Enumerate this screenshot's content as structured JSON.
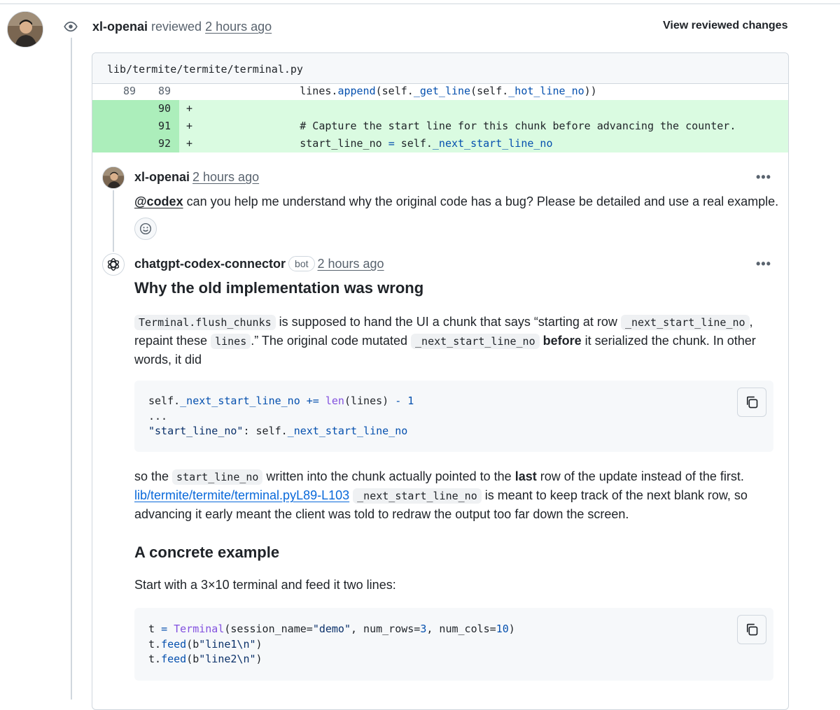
{
  "review": {
    "author": "xl-openai",
    "verb": "reviewed",
    "time": "2 hours ago",
    "view_changes_label": "View reviewed changes"
  },
  "file": {
    "path": "lib/termite/termite/terminal.py"
  },
  "diff": {
    "context_row": {
      "old": "89",
      "new": "89",
      "code_pre": "        lines.",
      "code_fn": "append",
      "code_mid": "(self.",
      "code_fn2": "_get_line",
      "code_mid2": "(self.",
      "code_attr": "_hot_line_no",
      "code_post": "))"
    },
    "added_rows": [
      {
        "new": "90",
        "marker": "+",
        "code": ""
      },
      {
        "new": "91",
        "marker": "+",
        "code": "        # Capture the start line for this chunk before advancing the counter."
      },
      {
        "new": "92",
        "marker": "+",
        "code_pre": "        start_line_no ",
        "code_op": "=",
        "code_mid": " self.",
        "code_attr": "_next_start_line_no"
      }
    ]
  },
  "comment1": {
    "author": "xl-openai",
    "time": "2 hours ago",
    "mention": "@codex",
    "text": " can you help me understand why the original code has a bug? Please be detailed and use a real example.",
    "more_label": "•••"
  },
  "comment2": {
    "author": "chatgpt-codex-connector",
    "badge": "bot",
    "time": "2 hours ago",
    "more_label": "•••",
    "heading1": "Why the old implementation was wrong",
    "p1": {
      "code1": "Terminal.flush_chunks",
      "t1": " is supposed to hand the UI a chunk that says “starting at row ",
      "code2": "_next_start_line_no",
      "t2": ",",
      "t3": "repaint these ",
      "code3": "lines",
      "t4": ".” The original code mutated ",
      "code4": "_next_start_line_no",
      "bold1": "before",
      "t5": " it serialized the chunk. In other",
      "t6": "words, it did"
    },
    "code_block1": {
      "line1_pre": "self.",
      "line1_attr": "_next_start_line_no",
      "line1_op": " +=",
      "line1_fn": " len",
      "line1_mid": "(lines) ",
      "line1_op2": "- 1",
      "line2": "...",
      "line3_str": "\"start_line_no\"",
      "line3_mid": ": self.",
      "line3_attr": "_next_start_line_no"
    },
    "p2": {
      "t1": "so the ",
      "code1": "start_line_no",
      "t2": " written into the chunk actually pointed to the ",
      "bold1": "last",
      "t3": " row of the update instead of the first.",
      "link1": "lib/termite/termite/terminal.pyL89-L103",
      "code2": "_next_start_line_no",
      "t4": " is meant to keep track of the next blank row, so",
      "t5": "advancing it early meant the client was told to redraw the output too far down the screen."
    },
    "heading2": "A concrete example",
    "p3": "Start with a 3×10 terminal and feed it two lines:",
    "code_block2": {
      "l1_a": "t ",
      "l1_op": "=",
      "l1_cls": " Terminal",
      "l1_b": "(session_name=",
      "l1_s1": "\"demo\"",
      "l1_c": ", num_rows=",
      "l1_n1": "3",
      "l1_d": ", num_cols=",
      "l1_n2": "10",
      "l1_e": ")",
      "l2_a": "t.",
      "l2_fn": "feed",
      "l2_b": "(b",
      "l2_s": "\"line1\\n\"",
      "l2_c": ")",
      "l3_a": "t.",
      "l3_fn": "feed",
      "l3_b": "(b",
      "l3_s": "\"line2\\n\"",
      "l3_c": ")"
    }
  }
}
